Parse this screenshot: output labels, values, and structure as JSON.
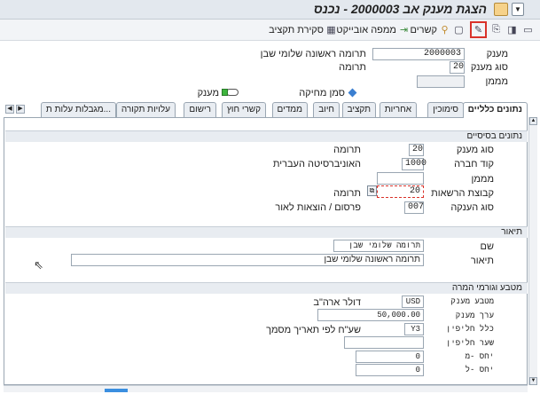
{
  "window": {
    "title": "הצגת מענק אב 2000003 - נכנס"
  },
  "toolbar": {
    "budget_closing": "סקירת תקציב",
    "object_map": "ממפה אובייקט",
    "links": "קשרים"
  },
  "header": {
    "grant_label": "מענק",
    "grant_value": "2000003",
    "grant_desc": "תרומה ראשונה שלומי שבן",
    "grant_type_label": "סוג מענק",
    "grant_type_value": "20",
    "grant_type_desc": "תרומה",
    "sponsor_label": "מממן",
    "sponsor_value": "",
    "legend_sponsor_grant": "סמן מחיקה",
    "legend_grant": "מענק"
  },
  "tabs": [
    "נתונים כלליים",
    "סימוכין",
    "אחריות",
    "תקציב",
    "חיוב",
    "ממדים",
    "קשרי חוץ",
    "רישום",
    "עלויות תקורה",
    "מגבלות עלות ת..."
  ],
  "basic_data": {
    "section_title": "נתונים בסיסיים",
    "rows": [
      {
        "label": "סוג מענק",
        "value": "20",
        "desc": "תרומה"
      },
      {
        "label": "קוד חברה",
        "value": "1000",
        "desc": "האוניברסיטה העברית"
      },
      {
        "label": "מממן",
        "value": "",
        "desc": ""
      },
      {
        "label": "קבוצת הרשאות",
        "value": "20",
        "desc": "תרומה"
      },
      {
        "label": "סוג הענקה",
        "value": "007",
        "desc": "פרסום / הוצאות לאור"
      }
    ]
  },
  "description": {
    "section_title": "תיאור",
    "name_label": "שם",
    "name_value": "תרומה שלומי שבן",
    "desc_label": "תיאור",
    "desc_value": "תרומה ראשונה שלומי שבן"
  },
  "currency": {
    "section_title": "מטבע וגורמי המרה",
    "rows": [
      {
        "label": "מטבע מענק",
        "value": "USD",
        "desc": "דולר ארה\"ב"
      },
      {
        "label": "ערך מענק",
        "value": "50,000.00",
        "desc": ""
      },
      {
        "label": "כלל חליפין",
        "value": "Y3",
        "desc": "שע\"ח לפי תאריך מסמך"
      },
      {
        "label": "שער חליפין",
        "value": "",
        "desc": ""
      },
      {
        "label": "יחס -מ",
        "value": "0",
        "desc": ""
      },
      {
        "label": "יחס -ל",
        "value": "0",
        "desc": ""
      }
    ]
  }
}
